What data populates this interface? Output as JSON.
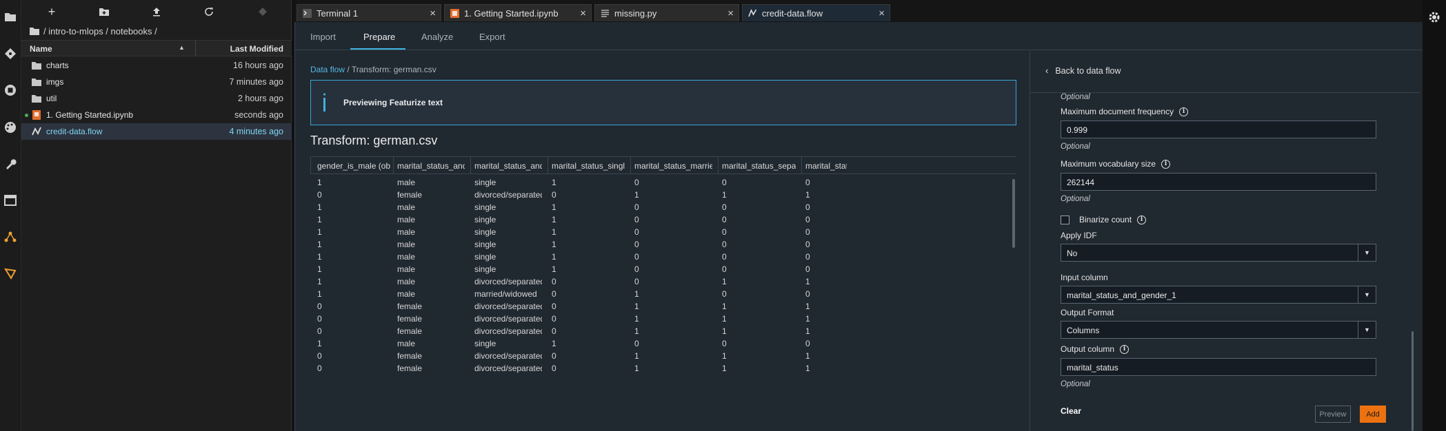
{
  "file_browser": {
    "breadcrumb": "/ intro-to-mlops / notebooks /",
    "header": {
      "name": "Name",
      "last_modified": "Last Modified"
    },
    "items": [
      {
        "name": "charts",
        "modified": "16 hours ago",
        "type": "folder"
      },
      {
        "name": "imgs",
        "modified": "7 minutes ago",
        "type": "folder"
      },
      {
        "name": "util",
        "modified": "2 hours ago",
        "type": "folder"
      },
      {
        "name": "1. Getting Started.ipynb",
        "modified": "seconds ago",
        "type": "notebook"
      },
      {
        "name": "credit-data.flow",
        "modified": "4 minutes ago",
        "type": "flow"
      }
    ]
  },
  "tabs": [
    {
      "label": "Terminal 1"
    },
    {
      "label": "1. Getting Started.ipynb"
    },
    {
      "label": "missing.py"
    },
    {
      "label": "credit-data.flow"
    }
  ],
  "subtabs": [
    "Import",
    "Prepare",
    "Analyze",
    "Export"
  ],
  "breadcrumb": {
    "link": "Data flow",
    "sep": "/",
    "current": "Transform: german.csv"
  },
  "banner": "Previewing Featurize text",
  "title": "Transform: german.csv",
  "table": {
    "columns": [
      "gender_is_male (obje...",
      "marital_status_and_...",
      "marital_status_and_...",
      "marital_status_single (...",
      "marital_status_married (...",
      "marital_status_separat...",
      "marital_stat"
    ],
    "rows": [
      [
        "1",
        "male",
        "single",
        "1",
        "0",
        "0",
        "0"
      ],
      [
        "0",
        "female",
        "divorced/separated/ma...",
        "0",
        "1",
        "1",
        "1"
      ],
      [
        "1",
        "male",
        "single",
        "1",
        "0",
        "0",
        "0"
      ],
      [
        "1",
        "male",
        "single",
        "1",
        "0",
        "0",
        "0"
      ],
      [
        "1",
        "male",
        "single",
        "1",
        "0",
        "0",
        "0"
      ],
      [
        "1",
        "male",
        "single",
        "1",
        "0",
        "0",
        "0"
      ],
      [
        "1",
        "male",
        "single",
        "1",
        "0",
        "0",
        "0"
      ],
      [
        "1",
        "male",
        "single",
        "1",
        "0",
        "0",
        "0"
      ],
      [
        "1",
        "male",
        "divorced/separated",
        "0",
        "0",
        "1",
        "1"
      ],
      [
        "1",
        "male",
        "married/widowed",
        "0",
        "1",
        "0",
        "0"
      ],
      [
        "0",
        "female",
        "divorced/separated/ma...",
        "0",
        "1",
        "1",
        "1"
      ],
      [
        "0",
        "female",
        "divorced/separated/ma...",
        "0",
        "1",
        "1",
        "1"
      ],
      [
        "0",
        "female",
        "divorced/separated/ma...",
        "0",
        "1",
        "1",
        "1"
      ],
      [
        "1",
        "male",
        "single",
        "1",
        "0",
        "0",
        "0"
      ],
      [
        "0",
        "female",
        "divorced/separated/ma...",
        "0",
        "1",
        "1",
        "1"
      ],
      [
        "0",
        "female",
        "divorced/separated/ma...",
        "0",
        "1",
        "1",
        "1"
      ]
    ]
  },
  "side_panel": {
    "back": "Back to data flow",
    "optional": "Optional",
    "max_doc_freq": {
      "label": "Maximum document frequency",
      "value": "0.999"
    },
    "max_vocab": {
      "label": "Maximum vocabulary size",
      "value": "262144"
    },
    "binarize": "Binarize count",
    "apply_idf": {
      "label": "Apply IDF",
      "value": "No"
    },
    "input_column": {
      "label": "Input column",
      "value": "marital_status_and_gender_1"
    },
    "output_format": {
      "label": "Output Format",
      "value": "Columns"
    },
    "output_column": {
      "label": "Output column",
      "value": "marital_status"
    },
    "clear": "Clear",
    "preview": "Preview",
    "add": "Add"
  },
  "colors": {
    "accent": "#3fb3e0",
    "add_button": "#ec7211",
    "selected_row": "#2d3440"
  }
}
